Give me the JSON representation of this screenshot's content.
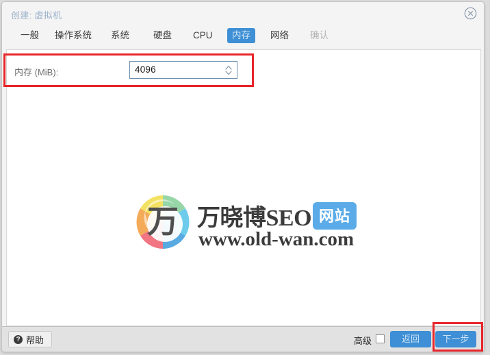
{
  "window": {
    "title": "创建: 虚拟机",
    "close_icon": "close-circle-icon"
  },
  "tabs": [
    {
      "label": "一般",
      "state": "normal"
    },
    {
      "label": "操作系统",
      "state": "normal"
    },
    {
      "label": "系统",
      "state": "normal"
    },
    {
      "label": "硬盘",
      "state": "normal"
    },
    {
      "label": "CPU",
      "state": "normal"
    },
    {
      "label": "内存",
      "state": "selected"
    },
    {
      "label": "网络",
      "state": "normal"
    },
    {
      "label": "确认",
      "state": "disabled"
    }
  ],
  "form": {
    "memory_label": "内存 (MiB):",
    "memory_value": "4096",
    "stepper_icon": "spinner-updown-icon"
  },
  "watermark": {
    "logo_char": "万",
    "title": "万晓博SEO",
    "badge": "网站",
    "url": "www.old-wan.com"
  },
  "footer": {
    "help_label": "帮助",
    "help_icon": "question-mark-icon",
    "advanced_label": "高级",
    "advanced_checked": false,
    "back_label": "返回",
    "next_label": "下一步"
  },
  "annotations": {
    "highlight_color": "#e8252a",
    "boxes": [
      "memory-row-highlight",
      "next-button-highlight"
    ]
  },
  "colors": {
    "accent": "#3e8fd5",
    "title": "#9db3cc",
    "highlight": "#e8252a",
    "badge": "#5aabe8"
  }
}
